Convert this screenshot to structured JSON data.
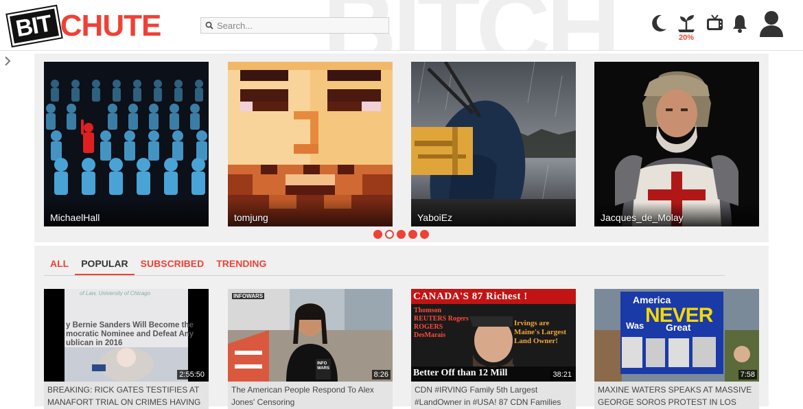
{
  "brand": {
    "bit": "BIT",
    "chute": "CHUTE",
    "watermark": "BITCH"
  },
  "search": {
    "placeholder": "Search..."
  },
  "header": {
    "upload_percent": "20%"
  },
  "carousel": {
    "creators": [
      {
        "name": "MichaelHall"
      },
      {
        "name": "tomjung"
      },
      {
        "name": "YaboiEz"
      },
      {
        "name": "Jacques_de_Molay"
      }
    ],
    "page_count": 5,
    "active_page": 2
  },
  "tabs": [
    {
      "label": "ALL"
    },
    {
      "label": "POPULAR"
    },
    {
      "label": "SUBSCRIBED"
    },
    {
      "label": "TRENDING"
    }
  ],
  "active_tab": "POPULAR",
  "videos": [
    {
      "duration": "2:55:50",
      "title": "BREAKING: RICK GATES TESTIFIES AT MANAFORT TRIAL ON CRIMES HAVING",
      "thumb_text": {
        "caption": "of Law, University of Chicago",
        "line1": "y Bernie Sanders Will Become the",
        "line2": "mocratic Nominee and Defeat Any",
        "line3": "ublican in 2016"
      }
    },
    {
      "duration": "8:26",
      "title": "The American People Respond To Alex Jones' Censoring",
      "thumb_text": {
        "brand": "INFOWARS",
        "mic": "INFO WARS"
      }
    },
    {
      "duration": "38:21",
      "title": "CDN #IRVING Family 5th Largest #LandOwner in #USA! 87 CDN Families",
      "thumb_text": {
        "top": "CANADA'S 87 Richest !",
        "bottom": "Better Off than 12 Mill",
        "names": "Thomson REUTERS Rogers ROGERS DesMarais",
        "irving": "Irvings are Maine's Largest Land Owner!"
      }
    },
    {
      "duration": "7:58",
      "title": "MAXINE WATERS SPEAKS AT MASSIVE GEORGE SOROS PROTEST IN LOS",
      "thumb_text": {
        "america": "America",
        "never": "NEVER",
        "was": "Was",
        "great": "Great"
      }
    }
  ],
  "colors": {
    "accent": "#ef4136",
    "panel": "#f0f0f0",
    "text": "#333333"
  },
  "icons": [
    "search-icon",
    "moon-icon",
    "upload-sprout-icon",
    "tv-icon",
    "bell-icon",
    "user-icon",
    "chevron-right-icon"
  ]
}
